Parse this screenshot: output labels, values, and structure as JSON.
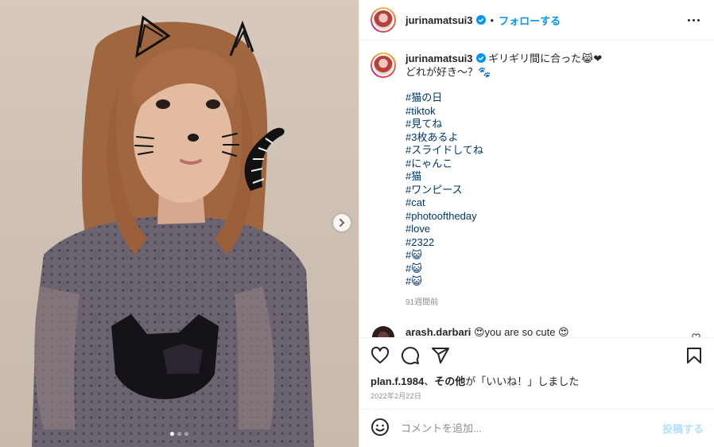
{
  "post": {
    "username": "jurinamatsui3",
    "follow_label": "フォローする",
    "separator": "•"
  },
  "caption": {
    "username": "jurinamatsui3",
    "line1": "ギリギリ間に合った😹❤",
    "line2": "どれが好き〜？🐾",
    "hashtags": [
      "#猫の日",
      "#tiktok",
      "#見てね",
      "#3枚あるよ",
      "#スライドしてね",
      "#にゃんこ",
      "#猫",
      "#ワンピース",
      "#cat",
      "#photooftheday",
      "#love",
      "#2322",
      "#😺",
      "#😺",
      "#😺"
    ],
    "time": "91週間前"
  },
  "comment": {
    "username": "arash.darbari",
    "text": "😍you are so cute 😍"
  },
  "likes": {
    "user": "plan.f.1984",
    "separator": "、",
    "others": "その他",
    "suffix": "が「いいね！」しました"
  },
  "date": "2022年2月22日",
  "add_comment": {
    "placeholder": "コメントを追加...",
    "post_label": "投稿する"
  },
  "carousel": {
    "slides": 3,
    "current": 1
  },
  "colors": {
    "accent": "#0095f6",
    "hashtag": "#00376b",
    "muted": "#8e8e8e"
  }
}
